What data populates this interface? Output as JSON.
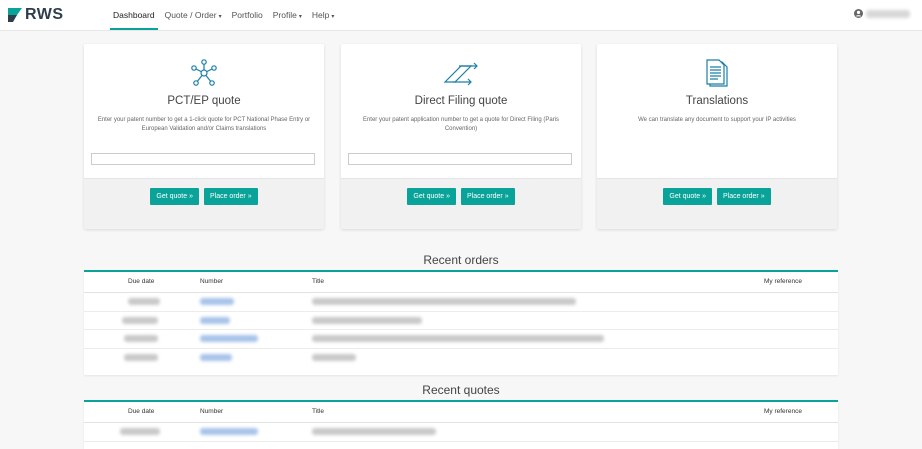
{
  "brand": {
    "name": "RWS"
  },
  "nav": {
    "items": [
      {
        "label": "Dashboard",
        "caret": "",
        "active": true
      },
      {
        "label": "Quote / Order",
        "caret": "▾"
      },
      {
        "label": "Portfolio",
        "caret": ""
      },
      {
        "label": "Profile",
        "caret": "▾"
      },
      {
        "label": "Help",
        "caret": "▾"
      }
    ]
  },
  "cards": [
    {
      "title": "PCT/EP quote",
      "description": "Enter your patent number to get a 1-click quote for PCT National Phase Entry or European Validation and/or Claims translations",
      "input_placeholder": "",
      "get_quote": "Get quote »",
      "place_order": "Place order »",
      "icon": "network-nodes-icon"
    },
    {
      "title": "Direct Filing quote",
      "description": "Enter your patent application number to get a quote for Direct Filing (Paris Convention)",
      "input_placeholder": "",
      "get_quote": "Get quote »",
      "place_order": "Place order »",
      "icon": "direct-filing-arrows-icon"
    },
    {
      "title": "Translations",
      "description": "We can translate any document to support your IP activities",
      "get_quote": "Get quote »",
      "place_order": "Place order »",
      "icon": "document-icon"
    }
  ],
  "recent_orders": {
    "title": "Recent orders",
    "columns": {
      "due_date": "Due date",
      "number": "Number",
      "title": "Title",
      "my_reference": "My reference"
    }
  },
  "recent_quotes": {
    "title": "Recent quotes",
    "columns": {
      "due_date": "Due date",
      "number": "Number",
      "title": "Title",
      "my_reference": "My reference"
    }
  },
  "colors": {
    "accent": "#0aa39a",
    "brand_dark": "#2f3d4c"
  }
}
